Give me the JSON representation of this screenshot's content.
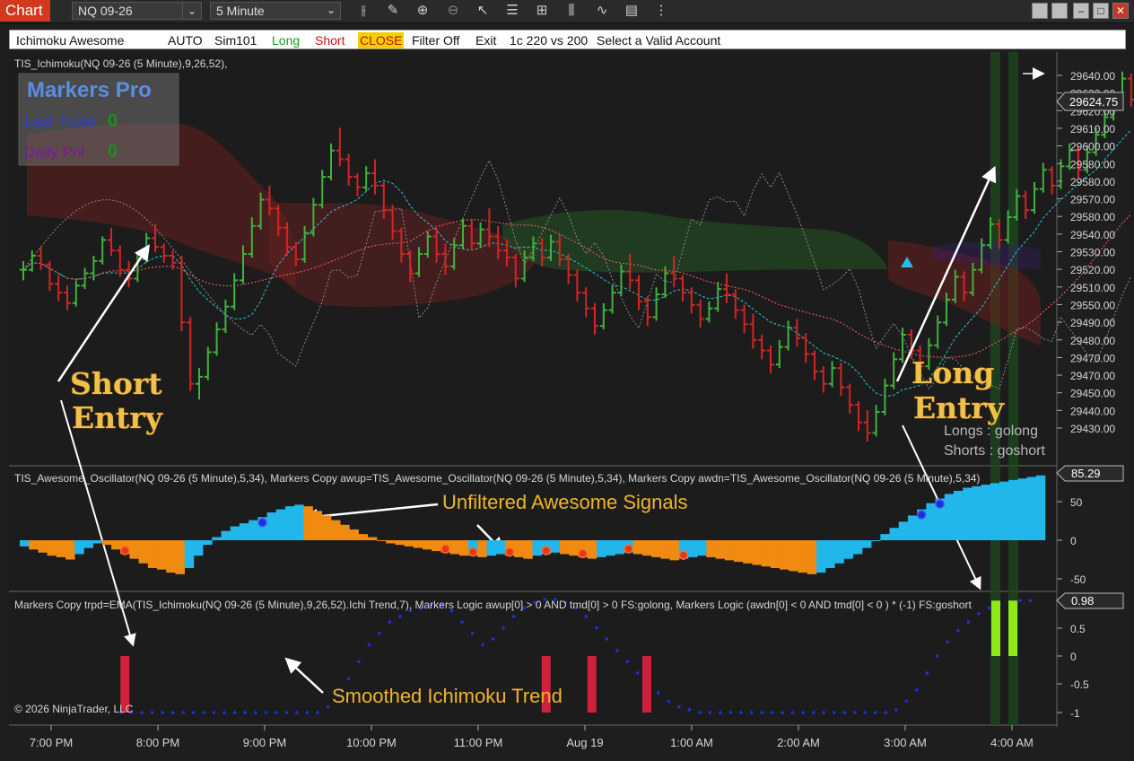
{
  "titlebar": {
    "chart_tab": "Chart",
    "instrument": "NQ 09-26",
    "interval": "5 Minute",
    "toolbar_icons": [
      "bar-type-icon",
      "draw-pencil-icon",
      "zoom-in-icon",
      "zoom-out-icon",
      "pointer-icon",
      "properties-icon",
      "data-box-icon",
      "indicators-icon",
      "strategies-icon",
      "chart-trader-icon",
      "more-icon"
    ]
  },
  "strategy": {
    "name": "Ichimoku Awesome",
    "mode": "AUTO",
    "account": "Sim101",
    "long": "Long",
    "short": "Short",
    "close": "CLOSE",
    "filter": "Filter Off",
    "exit": "Exit",
    "contracts": "1c 220 vs 200",
    "account_status": "Select a Valid Account"
  },
  "panel1": {
    "title": "TIS_Ichimoku(NQ 09-26 (5 Minute),9,26,52),",
    "markers_title": "Markers Pro",
    "last_trade_label": "Last Trade",
    "last_trade_value": "0",
    "daily_label": "Daily Pnl",
    "daily_value": "0",
    "price_current": "29624.75",
    "price_ticks": [
      "29640.00",
      "29630.00",
      "29620.00",
      "29610.00",
      "29600.00",
      "29580.00",
      "29580.00",
      "29570.00",
      "29580.00",
      "29540.00",
      "29530.00",
      "29520.00",
      "29510.00",
      "29550.00",
      "29490.00",
      "29480.00",
      "29470.00",
      "29470.00",
      "29450.00",
      "29440.00",
      "29430.00"
    ],
    "legend_longs": "Longs : golong",
    "legend_shorts": "Shorts : goshort",
    "ann_short": [
      "Short",
      "Entry"
    ],
    "ann_long": [
      "Long",
      "Entry"
    ]
  },
  "panel2": {
    "title": "TIS_Awesome_Oscillator(NQ 09-26 (5 Minute),5,34), Markers Copy awup=TIS_Awesome_Oscillator(NQ 09-26 (5 Minute),5,34), Markers Copy awdn=TIS_Awesome_Oscillator(NQ 09-26 (5 Minute),5,34)",
    "current": "85.29",
    "ticks": [
      "50",
      "0",
      "-50"
    ],
    "annotation": "Unfiltered Awesome Signals"
  },
  "panel3": {
    "title": "Markers Copy trpd=EMA(TIS_Ichimoku(NQ 09-26 (5 Minute),9,26,52).Ichi Trend,7), Markers Logic awup[0]  > 0 AND tmd[0] > 0  FS:golong, Markers Logic (awdn[0] < 0  AND tmd[0] < 0 ) * (-1)  FS:goshort",
    "current": "0.98",
    "ticks": [
      "0.5",
      "0",
      "-0.5",
      "-1"
    ],
    "annotation": "Smoothed Ichimoku Trend",
    "copyright": "© 2026 NinjaTrader, LLC"
  },
  "time_axis": [
    "7:00 PM",
    "8:00 PM",
    "9:00 PM",
    "10:00 PM",
    "11:00 PM",
    "Aug 19",
    "1:00 AM",
    "2:00 AM",
    "3:00 AM",
    "4:00 AM"
  ],
  "colors": {
    "up_bar": "#3fb23f",
    "down_bar": "#d42424",
    "ao_up": "#22b7ea",
    "ao_down": "#f08a10",
    "signal_long": "#8fe81a",
    "signal_short": "#d0213a",
    "trend_dots": "#1f2fd6",
    "annotation_text": "#f0b428"
  },
  "chart_data": {
    "type": "candlestick",
    "bars_per_hour": 12,
    "price_ohlc": [
      [
        29527,
        29532,
        29521,
        29527
      ],
      [
        29527,
        29538,
        29526,
        29535
      ],
      [
        29535,
        29540,
        29527,
        29530
      ],
      [
        29530,
        29532,
        29515,
        29519
      ],
      [
        29519,
        29524,
        29509,
        29514
      ],
      [
        29514,
        29518,
        29504,
        29508
      ],
      [
        29508,
        29521,
        29506,
        29518
      ],
      [
        29518,
        29528,
        29516,
        29525
      ],
      [
        29525,
        29535,
        29521,
        29532
      ],
      [
        29532,
        29546,
        29530,
        29544
      ],
      [
        29544,
        29551,
        29535,
        29538
      ],
      [
        29538,
        29541,
        29523,
        29527
      ],
      [
        29527,
        29532,
        29517,
        29522
      ],
      [
        29522,
        29536,
        29520,
        29533
      ],
      [
        29533,
        29548,
        29531,
        29545
      ],
      [
        29545,
        29553,
        29537,
        29540
      ],
      [
        29540,
        29542,
        29531,
        29535
      ],
      [
        29535,
        29538,
        29527,
        29531
      ],
      [
        29531,
        29535,
        29492,
        29497
      ],
      [
        29497,
        29500,
        29458,
        29462
      ],
      [
        29462,
        29471,
        29453,
        29466
      ],
      [
        29466,
        29483,
        29464,
        29480
      ],
      [
        29480,
        29497,
        29478,
        29493
      ],
      [
        29493,
        29510,
        29491,
        29506
      ],
      [
        29506,
        29525,
        29504,
        29521
      ],
      [
        29521,
        29541,
        29519,
        29536
      ],
      [
        29536,
        29557,
        29534,
        29552
      ],
      [
        29552,
        29571,
        29550,
        29567
      ],
      [
        29567,
        29575,
        29558,
        29562
      ],
      [
        29562,
        29564,
        29546,
        29551
      ],
      [
        29551,
        29554,
        29535,
        29540
      ],
      [
        29540,
        29543,
        29529,
        29533
      ],
      [
        29533,
        29552,
        29531,
        29548
      ],
      [
        29548,
        29568,
        29546,
        29564
      ],
      [
        29564,
        29584,
        29562,
        29580
      ],
      [
        29580,
        29599,
        29578,
        29595
      ],
      [
        29595,
        29608,
        29586,
        29590
      ],
      [
        29590,
        29593,
        29575,
        29580
      ],
      [
        29580,
        29582,
        29569,
        29574
      ],
      [
        29574,
        29586,
        29572,
        29582
      ],
      [
        29582,
        29590,
        29570,
        29575
      ],
      [
        29575,
        29577,
        29556,
        29561
      ],
      [
        29561,
        29564,
        29544,
        29549
      ],
      [
        29549,
        29551,
        29531,
        29536
      ],
      [
        29536,
        29538,
        29520,
        29525
      ],
      [
        29525,
        29540,
        29523,
        29536
      ],
      [
        29536,
        29549,
        29534,
        29546
      ],
      [
        29546,
        29551,
        29531,
        29536
      ],
      [
        29536,
        29542,
        29524,
        29529
      ],
      [
        29529,
        29545,
        29527,
        29541
      ],
      [
        29541,
        29556,
        29539,
        29552
      ],
      [
        29552,
        29556,
        29538,
        29542
      ],
      [
        29542,
        29554,
        29540,
        29550
      ],
      [
        29550,
        29562,
        29540,
        29546
      ],
      [
        29546,
        29552,
        29533,
        29538
      ],
      [
        29538,
        29544,
        29529,
        29534
      ],
      [
        29534,
        29536,
        29517,
        29522
      ],
      [
        29522,
        29538,
        29520,
        29534
      ],
      [
        29534,
        29546,
        29532,
        29542
      ],
      [
        29542,
        29545,
        29529,
        29534
      ],
      [
        29534,
        29547,
        29532,
        29543
      ],
      [
        29543,
        29547,
        29529,
        29533
      ],
      [
        29533,
        29536,
        29519,
        29524
      ],
      [
        29524,
        29527,
        29509,
        29514
      ],
      [
        29514,
        29517,
        29500,
        29505
      ],
      [
        29505,
        29508,
        29490,
        29495
      ],
      [
        29495,
        29508,
        29493,
        29504
      ],
      [
        29504,
        29518,
        29502,
        29514
      ],
      [
        29514,
        29530,
        29512,
        29526
      ],
      [
        29526,
        29536,
        29516,
        29521
      ],
      [
        29521,
        29524,
        29504,
        29509
      ],
      [
        29509,
        29512,
        29495,
        29500
      ],
      [
        29500,
        29517,
        29498,
        29513
      ],
      [
        29513,
        29529,
        29511,
        29525
      ],
      [
        29525,
        29535,
        29517,
        29522
      ],
      [
        29522,
        29524,
        29509,
        29514
      ],
      [
        29514,
        29517,
        29502,
        29507
      ],
      [
        29507,
        29510,
        29494,
        29499
      ],
      [
        29499,
        29509,
        29497,
        29505
      ],
      [
        29505,
        29520,
        29503,
        29516
      ],
      [
        29516,
        29525,
        29508,
        29513
      ],
      [
        29513,
        29516,
        29499,
        29504
      ],
      [
        29504,
        29507,
        29491,
        29496
      ],
      [
        29496,
        29502,
        29482,
        29487
      ],
      [
        29487,
        29490,
        29476,
        29481
      ],
      [
        29481,
        29484,
        29468,
        29473
      ],
      [
        29473,
        29487,
        29471,
        29483
      ],
      [
        29483,
        29498,
        29481,
        29494
      ],
      [
        29494,
        29499,
        29483,
        29488
      ],
      [
        29488,
        29491,
        29474,
        29479
      ],
      [
        29479,
        29481,
        29464,
        29469
      ],
      [
        29469,
        29472,
        29457,
        29462
      ],
      [
        29462,
        29475,
        29460,
        29471
      ],
      [
        29471,
        29474,
        29455,
        29460
      ],
      [
        29460,
        29462,
        29445,
        29450
      ],
      [
        29450,
        29452,
        29435,
        29440
      ],
      [
        29440,
        29447,
        29429,
        29434
      ],
      [
        29434,
        29450,
        29432,
        29446
      ],
      [
        29446,
        29465,
        29444,
        29461
      ],
      [
        29461,
        29480,
        29459,
        29476
      ],
      [
        29476,
        29494,
        29474,
        29490
      ],
      [
        29490,
        29493,
        29476,
        29481
      ],
      [
        29481,
        29484,
        29467,
        29472
      ],
      [
        29472,
        29488,
        29470,
        29484
      ],
      [
        29484,
        29501,
        29482,
        29497
      ],
      [
        29497,
        29514,
        29495,
        29510
      ],
      [
        29510,
        29527,
        29508,
        29523
      ],
      [
        29523,
        29526,
        29509,
        29514
      ],
      [
        29514,
        29531,
        29512,
        29527
      ],
      [
        29527,
        29545,
        29525,
        29541
      ],
      [
        29541,
        29557,
        29539,
        29553
      ],
      [
        29553,
        29556,
        29539,
        29544
      ],
      [
        29544,
        29561,
        29542,
        29557
      ],
      [
        29557,
        29573,
        29555,
        29569
      ],
      [
        29569,
        29572,
        29556,
        29561
      ],
      [
        29561,
        29577,
        29559,
        29573
      ],
      [
        29573,
        29588,
        29571,
        29584
      ],
      [
        29584,
        29586,
        29570,
        29575
      ],
      [
        29575,
        29590,
        29573,
        29586
      ],
      [
        29586,
        29599,
        29584,
        29595
      ],
      [
        29595,
        29597,
        29579,
        29584
      ],
      [
        29584,
        29598,
        29582,
        29594
      ],
      [
        29594,
        29608,
        29592,
        29604
      ],
      [
        29604,
        29618,
        29602,
        29614
      ],
      [
        29614,
        29628,
        29612,
        29624
      ],
      [
        29624,
        29640,
        29622,
        29636
      ],
      [
        29636,
        29639,
        29620,
        29624
      ]
    ],
    "ao_histogram": [
      -8,
      -12,
      -16,
      -20,
      -22,
      -25,
      -18,
      -10,
      -4,
      -6,
      -12,
      -18,
      -24,
      -30,
      -36,
      -38,
      -42,
      -44,
      -36,
      -20,
      -6,
      4,
      12,
      18,
      22,
      26,
      30,
      36,
      40,
      44,
      46,
      44,
      38,
      32,
      26,
      20,
      14,
      8,
      4,
      0,
      -4,
      -6,
      -8,
      -10,
      -12,
      -14,
      -16,
      -18,
      -20,
      -20,
      -22,
      -20,
      -18,
      -20,
      -22,
      -24,
      -20,
      -18,
      -16,
      -18,
      -20,
      -22,
      -24,
      -22,
      -20,
      -18,
      -16,
      -18,
      -20,
      -22,
      -24,
      -26,
      -24,
      -22,
      -20,
      -22,
      -24,
      -26,
      -28,
      -30,
      -32,
      -34,
      -36,
      -38,
      -40,
      -42,
      -44,
      -42,
      -36,
      -30,
      -24,
      -18,
      -10,
      0,
      8,
      16,
      24,
      32,
      40,
      48,
      54,
      60,
      64,
      68,
      70,
      72,
      74,
      76,
      78,
      80,
      82,
      84
    ],
    "ao_markers": [
      {
        "bar": 11,
        "type": "short"
      },
      {
        "bar": 26,
        "type": "long"
      },
      {
        "bar": 46,
        "type": "short"
      },
      {
        "bar": 49,
        "type": "short"
      },
      {
        "bar": 53,
        "type": "short"
      },
      {
        "bar": 57,
        "type": "short"
      },
      {
        "bar": 61,
        "type": "short"
      },
      {
        "bar": 66,
        "type": "short"
      },
      {
        "bar": 72,
        "type": "short"
      },
      {
        "bar": 98,
        "type": "long"
      },
      {
        "bar": 100,
        "type": "long"
      }
    ],
    "trend_ema": [
      -1,
      -1,
      -1,
      -1,
      -1,
      -1,
      -1,
      -1,
      -1,
      -1,
      -1,
      -1,
      -1,
      -1,
      -1,
      -1,
      -1,
      -1,
      -1,
      -1,
      -0.9,
      -0.7,
      -0.4,
      -0.1,
      0.2,
      0.4,
      0.6,
      0.7,
      0.8,
      0.85,
      0.9,
      0.9,
      0.8,
      0.6,
      0.4,
      0.2,
      0.3,
      0.5,
      0.7,
      0.85,
      0.95,
      1,
      1,
      0.95,
      0.85,
      0.7,
      0.5,
      0.3,
      0.1,
      -0.1,
      -0.3,
      -0.5,
      -0.65,
      -0.8,
      -0.9,
      -0.95,
      -1,
      -1,
      -1,
      -1,
      -1,
      -1,
      -1,
      -1,
      -1,
      -1,
      -1,
      -1,
      -1,
      -1,
      -1,
      -1,
      -1,
      -1,
      -1,
      -0.95,
      -0.8,
      -0.6,
      -0.3,
      0,
      0.25,
      0.45,
      0.6,
      0.75,
      0.85,
      0.92,
      0.96,
      0.98,
      0.98
    ],
    "signals": [
      {
        "bar": 11,
        "direction": "short"
      },
      {
        "bar": 57,
        "direction": "short"
      },
      {
        "bar": 62,
        "direction": "short"
      },
      {
        "bar": 68,
        "direction": "short"
      },
      {
        "bar": 98,
        "direction": "long"
      },
      {
        "bar": 100,
        "direction": "long"
      }
    ],
    "ylim_price": [
      29425,
      29645
    ],
    "ylim_ao": [
      -60,
      90
    ],
    "ylim_trend": [
      -1.1,
      1.1
    ]
  }
}
